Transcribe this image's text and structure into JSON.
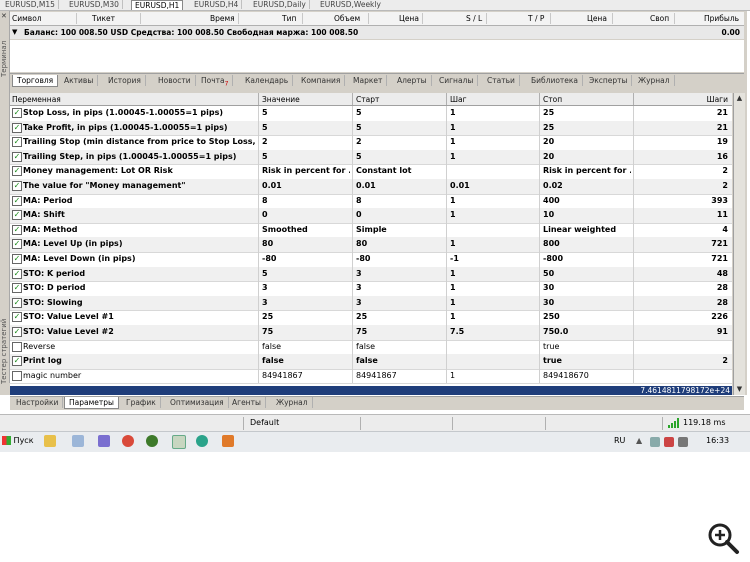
{
  "chart_tabs": [
    "EURUSD,M15",
    "EURUSD,M30",
    "EURUSD,H1",
    "EURUSD,H4",
    "EURUSD,Daily",
    "EURUSD,Weekly"
  ],
  "active_chart_tab": "EURUSD,H1",
  "side_labels": {
    "terminal": "Терминал",
    "tester": "Тестер стратегий"
  },
  "trade_headers": [
    "Символ",
    "Тикет",
    "Время",
    "Тип",
    "Объем",
    "Цена",
    "S / L",
    "T / P",
    "Цена",
    "Своп",
    "Прибыль"
  ],
  "balance": {
    "text": "Баланс: 100 008.50 USD  Средства: 100 008.50  Свободная маржа: 100 008.50",
    "value": "0.00"
  },
  "terminal_tabs": [
    "Торговля",
    "Активы",
    "История",
    "Новости",
    "Почта",
    "Календарь",
    "Компания",
    "Маркет",
    "Алерты",
    "Сигналы",
    "Статьи",
    "Библиотека",
    "Эксперты",
    "Журнал"
  ],
  "mail_count": "7",
  "grid_headers": {
    "variable": "Переменная",
    "value": "Значение",
    "start": "Старт",
    "step": "Шаг",
    "stop": "Стоп",
    "steps": "Шаги"
  },
  "params": [
    {
      "checked": true,
      "name": "Stop Loss, in pips (1.00045-1.00055=1 pips)",
      "value": "5",
      "start": "5",
      "step": "1",
      "stop": "25",
      "steps": "21"
    },
    {
      "checked": true,
      "name": "Take Profit, in pips (1.00045-1.00055=1 pips)",
      "value": "5",
      "start": "5",
      "step": "1",
      "stop": "25",
      "steps": "21"
    },
    {
      "checked": true,
      "name": "Trailing Stop (min distance from price to Stop Loss, in ...",
      "value": "2",
      "start": "2",
      "step": "1",
      "stop": "20",
      "steps": "19"
    },
    {
      "checked": true,
      "name": "Trailing Step, in pips (1.00045-1.00055=1 pips)",
      "value": "5",
      "start": "5",
      "step": "1",
      "stop": "20",
      "steps": "16"
    },
    {
      "checked": true,
      "name": "Money management: Lot OR Risk",
      "value": "Risk in percent for ...",
      "start": "Constant lot",
      "step": "",
      "stop": "Risk in percent for ...",
      "steps": "2"
    },
    {
      "checked": true,
      "name": "The value for \"Money management\"",
      "value": "0.01",
      "start": "0.01",
      "step": "0.01",
      "stop": "0.02",
      "steps": "2"
    },
    {
      "checked": true,
      "name": "MA: Period",
      "value": "8",
      "start": "8",
      "step": "1",
      "stop": "400",
      "steps": "393"
    },
    {
      "checked": true,
      "name": "MA: Shift",
      "value": "0",
      "start": "0",
      "step": "1",
      "stop": "10",
      "steps": "11"
    },
    {
      "checked": true,
      "name": "MA: Method",
      "value": "Smoothed",
      "start": "Simple",
      "step": "",
      "stop": "Linear weighted",
      "steps": "4"
    },
    {
      "checked": true,
      "name": "MA: Level Up (in pips)",
      "value": "80",
      "start": "80",
      "step": "1",
      "stop": "800",
      "steps": "721"
    },
    {
      "checked": true,
      "name": "MA: Level Down (in pips)",
      "value": "-80",
      "start": "-80",
      "step": "-1",
      "stop": "-800",
      "steps": "721"
    },
    {
      "checked": true,
      "name": "STO: K period",
      "value": "5",
      "start": "3",
      "step": "1",
      "stop": "50",
      "steps": "48"
    },
    {
      "checked": true,
      "name": "STO: D period",
      "value": "3",
      "start": "3",
      "step": "1",
      "stop": "30",
      "steps": "28"
    },
    {
      "checked": true,
      "name": "STO: Slowing",
      "value": "3",
      "start": "3",
      "step": "1",
      "stop": "30",
      "steps": "28"
    },
    {
      "checked": true,
      "name": "STO: Value Level #1",
      "value": "25",
      "start": "25",
      "step": "1",
      "stop": "250",
      "steps": "226"
    },
    {
      "checked": true,
      "name": "STO: Value Level #2",
      "value": "75",
      "start": "75",
      "step": "7.5",
      "stop": "750.0",
      "steps": "91"
    },
    {
      "checked": false,
      "name": "Reverse",
      "value": "false",
      "start": "false",
      "step": "",
      "stop": "true",
      "steps": ""
    },
    {
      "checked": true,
      "name": "Print log",
      "value": "false",
      "start": "false",
      "step": "",
      "stop": "true",
      "steps": "2"
    },
    {
      "checked": false,
      "name": "magic number",
      "value": "84941867",
      "start": "84941867",
      "step": "1",
      "stop": "849418670",
      "steps": ""
    }
  ],
  "total_steps": "7.4614811798172e+24",
  "tester_tabs": [
    "Настройки",
    "Параметры",
    "График",
    "Оптимизация",
    "Агенты",
    "Журнал"
  ],
  "active_tester_tab": "Параметры",
  "status": {
    "profile": "Default",
    "ping": "119.18 ms"
  },
  "taskbar": {
    "start": "Пуск",
    "lang": "RU",
    "time": "16:33"
  },
  "colors": {
    "check": "#1a8a1a",
    "selection": "#1f3d7a",
    "signal": "#2aa52a"
  }
}
